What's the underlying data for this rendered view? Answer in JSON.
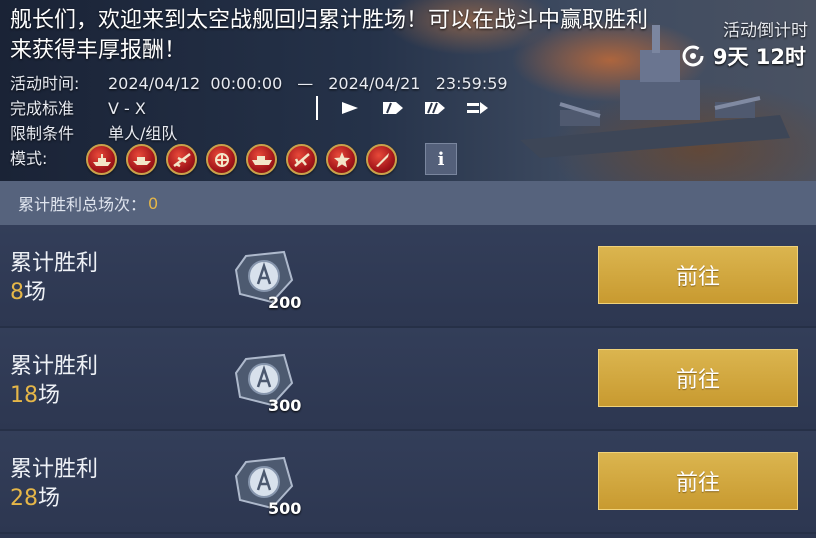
{
  "header": {
    "headline": "舰长们，欢迎来到太空战舰回归累计胜场！可以在战斗中赢取胜利来获得丰厚报酬！",
    "countdown_label": "活动倒计时",
    "countdown_value": "9天 12时",
    "info": {
      "time_key": "活动时间:",
      "time_start": "2024/04/12  00:00:00",
      "time_sep": "—",
      "time_end": "2024/04/21   23:59:59",
      "standard_key": "完成标准",
      "standard_value": "V - X",
      "limit_key": "限制条件",
      "limit_value": "单人/组队",
      "mode_key": "模式:"
    },
    "mode_icons": [
      "battleship-mode-icon",
      "destroyer-mode-icon",
      "aircraft-mode-icon",
      "submarine-mode-icon",
      "carrier-mode-icon",
      "cruiser-mode-icon",
      "star-mode-icon",
      "missile-mode-icon"
    ],
    "info_button": "i"
  },
  "total": {
    "label": "累计胜利总场次：",
    "value": "0"
  },
  "rows": [
    {
      "title": "累计胜利",
      "count": "8",
      "unit": "场",
      "reward": "200",
      "button": "前往"
    },
    {
      "title": "累计胜利",
      "count": "18",
      "unit": "场",
      "reward": "300",
      "button": "前往"
    },
    {
      "title": "累计胜利",
      "count": "28",
      "unit": "场",
      "reward": "500",
      "button": "前往"
    }
  ],
  "colors": {
    "accent_gold": "#e5b648",
    "button_gold": "#d4aa42",
    "background": "#2c3650"
  }
}
